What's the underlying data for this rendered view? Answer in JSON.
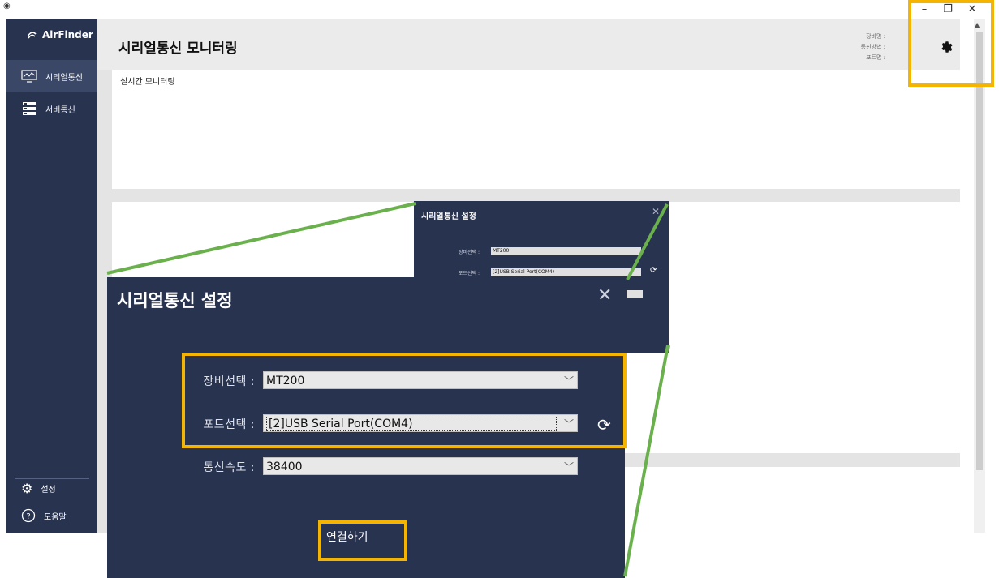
{
  "window": {
    "minimize": "–",
    "restore": "❐",
    "close": "✕"
  },
  "sidebar": {
    "brand": "AirFinder",
    "items": [
      {
        "label": "시리얼통신",
        "icon": "monitor-chart-icon",
        "active": true
      },
      {
        "label": "서버통신",
        "icon": "server-icon",
        "active": false
      }
    ],
    "bottom_items": [
      {
        "label": "설정",
        "icon": "gear-icon"
      },
      {
        "label": "도움말",
        "icon": "help-icon"
      }
    ]
  },
  "header": {
    "title": "시리얼통신 모니터링",
    "meta": [
      "장비명 :",
      "통신방법 :",
      "포트명 :"
    ]
  },
  "main": {
    "realtime_label": "실시간 모니터링"
  },
  "small_dialog": {
    "title": "시리얼통신 설정",
    "close": "✕",
    "device_label": "장비선택 :",
    "device_value": "MT200",
    "port_label": "포트선택 :",
    "port_value": "[2]USB Serial Port(COM4)"
  },
  "big_dialog": {
    "title": "시리얼통신 설정",
    "close": "✕",
    "device_label": "장비선택 :",
    "device_value": "MT200",
    "port_label": "포트선택 :",
    "port_value": "[2]USB Serial Port(COM4)",
    "baud_label": "통신속도 :",
    "baud_value": "38400",
    "connect_label": "연결하기"
  },
  "colors": {
    "sidebar": "#283350",
    "highlight": "#f5b400",
    "callout": "#6ab04c"
  }
}
